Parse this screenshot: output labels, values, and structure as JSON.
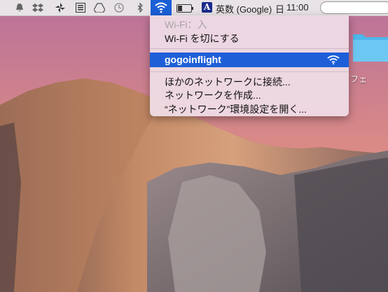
{
  "menubar": {
    "ime_label": "英数 (Google)",
    "day": "日",
    "time": "11:00",
    "icons": [
      "notification-icon",
      "dropbox-icon",
      "pinwheel-icon",
      "list-icon",
      "google-drive-icon",
      "time-machine-icon",
      "bluetooth-icon",
      "wifi-icon",
      "battery-icon",
      "input-method-icon",
      "search-icon"
    ]
  },
  "wifi_menu": {
    "status": "Wi-Fi：入",
    "toggle": "Wi-Fi を切にする",
    "networks": [
      {
        "name": "gogoinflight",
        "selected": true
      }
    ],
    "join_other": "ほかのネットワークに接続...",
    "create": "ネットワークを作成...",
    "open_prefs": "“ネットワーク”環境設定を開く..."
  },
  "desktop": {
    "folder_label_partial": "フェ"
  },
  "colors": {
    "highlight": "#1e5fd8",
    "menubar": "#ececec"
  }
}
